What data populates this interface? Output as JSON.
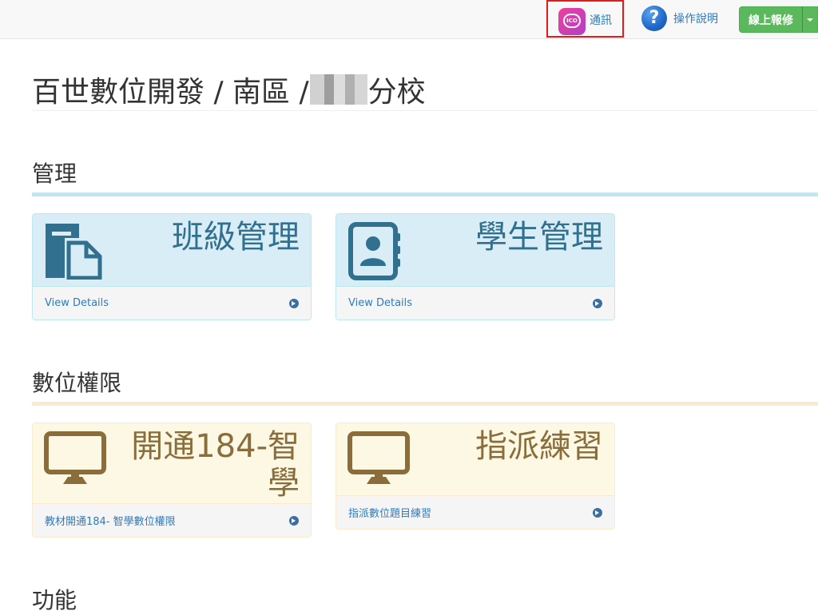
{
  "navbar": {
    "messenger_icon_text": "ICO",
    "messenger_label": "通訊",
    "help_icon_glyph": "?",
    "help_label": "操作說明",
    "repair_button_label": "線上報修"
  },
  "header": {
    "title_prefix": "百世數位開發 / 南區 / ",
    "title_suffix": "分校"
  },
  "sections": [
    {
      "title": "管理",
      "accent_color": "#bce8f1",
      "cards": [
        {
          "title": "班級管理",
          "icon": "document-icon",
          "link": "View Details"
        },
        {
          "title": "學生管理",
          "icon": "contact-book-icon",
          "link": "View Details"
        }
      ]
    },
    {
      "title": "數位權限",
      "accent_color": "#faebcc",
      "cards": [
        {
          "title": "開通184-智學",
          "icon": "monitor-icon",
          "link": "教材開通184- 智學數位權限"
        },
        {
          "title": "指派練習",
          "icon": "monitor-icon",
          "link": "指派數位題目練習"
        }
      ]
    },
    {
      "title": "功能"
    }
  ],
  "colors": {
    "primary_link": "#337ab7",
    "success": "#5cb85c",
    "highlight_border": "#e21b1b",
    "info_bg": "#d9edf7",
    "info_text": "#31708f",
    "warning_bg": "#fcf8e3",
    "warning_text": "#8a6d3b"
  }
}
